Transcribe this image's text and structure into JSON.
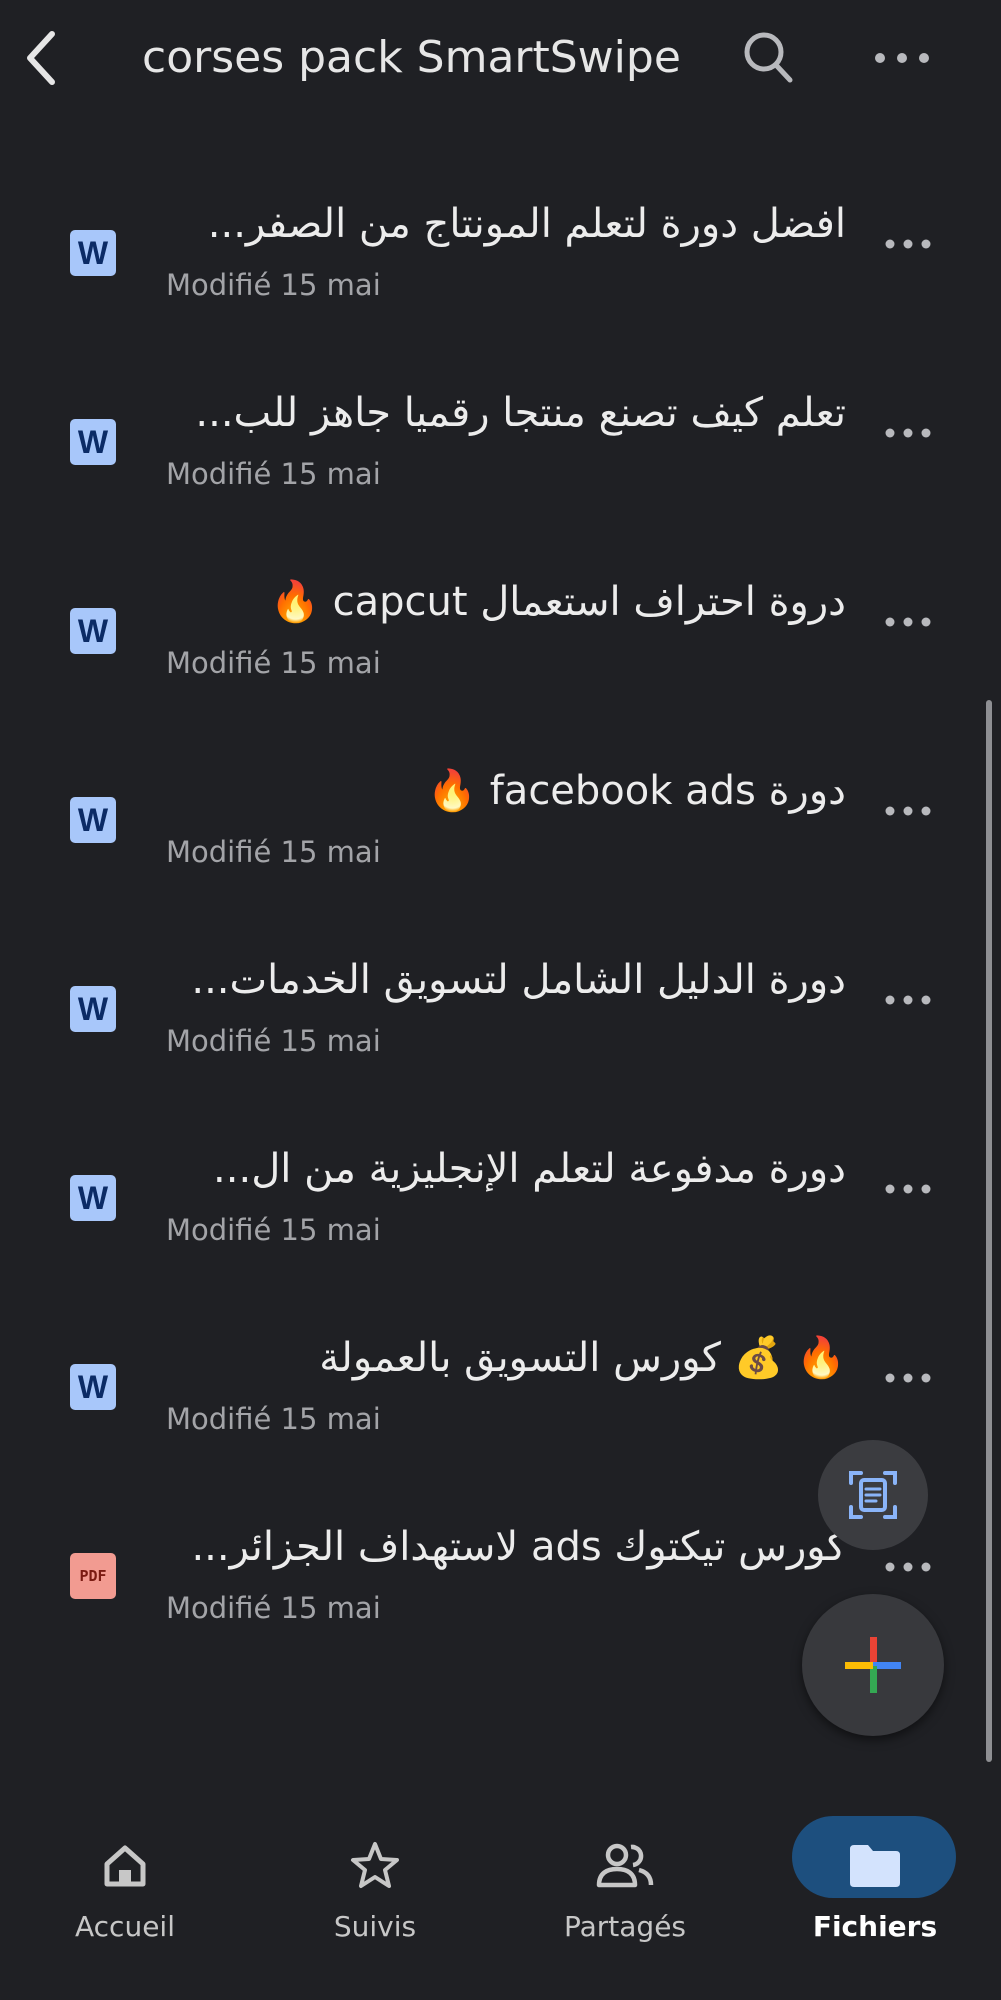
{
  "header": {
    "title": "corses pack SmartSwipe",
    "back_icon": "back-arrow-icon",
    "search_icon": "search-icon",
    "more_icon": "more-horizontal-icon"
  },
  "files": [
    {
      "name": "افضل دورة لتعلم المونتاج من الصفر...",
      "meta": "Modifié 15 mai",
      "type": "word"
    },
    {
      "name": "تعلم كيف تصنع منتجا رقميا جاهز للب...",
      "meta": "Modifié 15 mai",
      "type": "word"
    },
    {
      "name": "🔥 capcut دروة احتراف استعمال",
      "meta": "Modifié 15 mai",
      "type": "word"
    },
    {
      "name": "🔥 facebook ads دورة",
      "meta": "Modifié 15 mai",
      "type": "word"
    },
    {
      "name": "دورة الدليل الشامل لتسويق الخدمات...",
      "meta": "Modifié 15 mai",
      "type": "word"
    },
    {
      "name": "دورة مدفوعة لتعلم الإنجليزية من ال...",
      "meta": "Modifié 15 mai",
      "type": "word"
    },
    {
      "name": "🔥 💰 كورس التسويق بالعمولة",
      "meta": "Modifié 15 mai",
      "type": "word"
    },
    {
      "name": "كورس تيكتوك ads لاستهداف الجزائر...",
      "meta": "Modifié 15 mai",
      "type": "pdf"
    }
  ],
  "icons": {
    "word_letter": "W",
    "pdf_label": "PDF"
  },
  "fab": {
    "scan_icon": "document-scan-icon",
    "new_icon": "plus-icon"
  },
  "bottom_nav": [
    {
      "label": "Accueil",
      "icon": "home-icon",
      "active": false
    },
    {
      "label": "Suivis",
      "icon": "star-icon",
      "active": false
    },
    {
      "label": "Partagés",
      "icon": "people-icon",
      "active": false
    },
    {
      "label": "Fichiers",
      "icon": "folder-icon",
      "active": true
    }
  ],
  "colors": {
    "background": "#1f2024",
    "word_icon": "#a8c7fa",
    "pdf_icon": "#f29b91",
    "active_pill": "#1d4f7e"
  }
}
